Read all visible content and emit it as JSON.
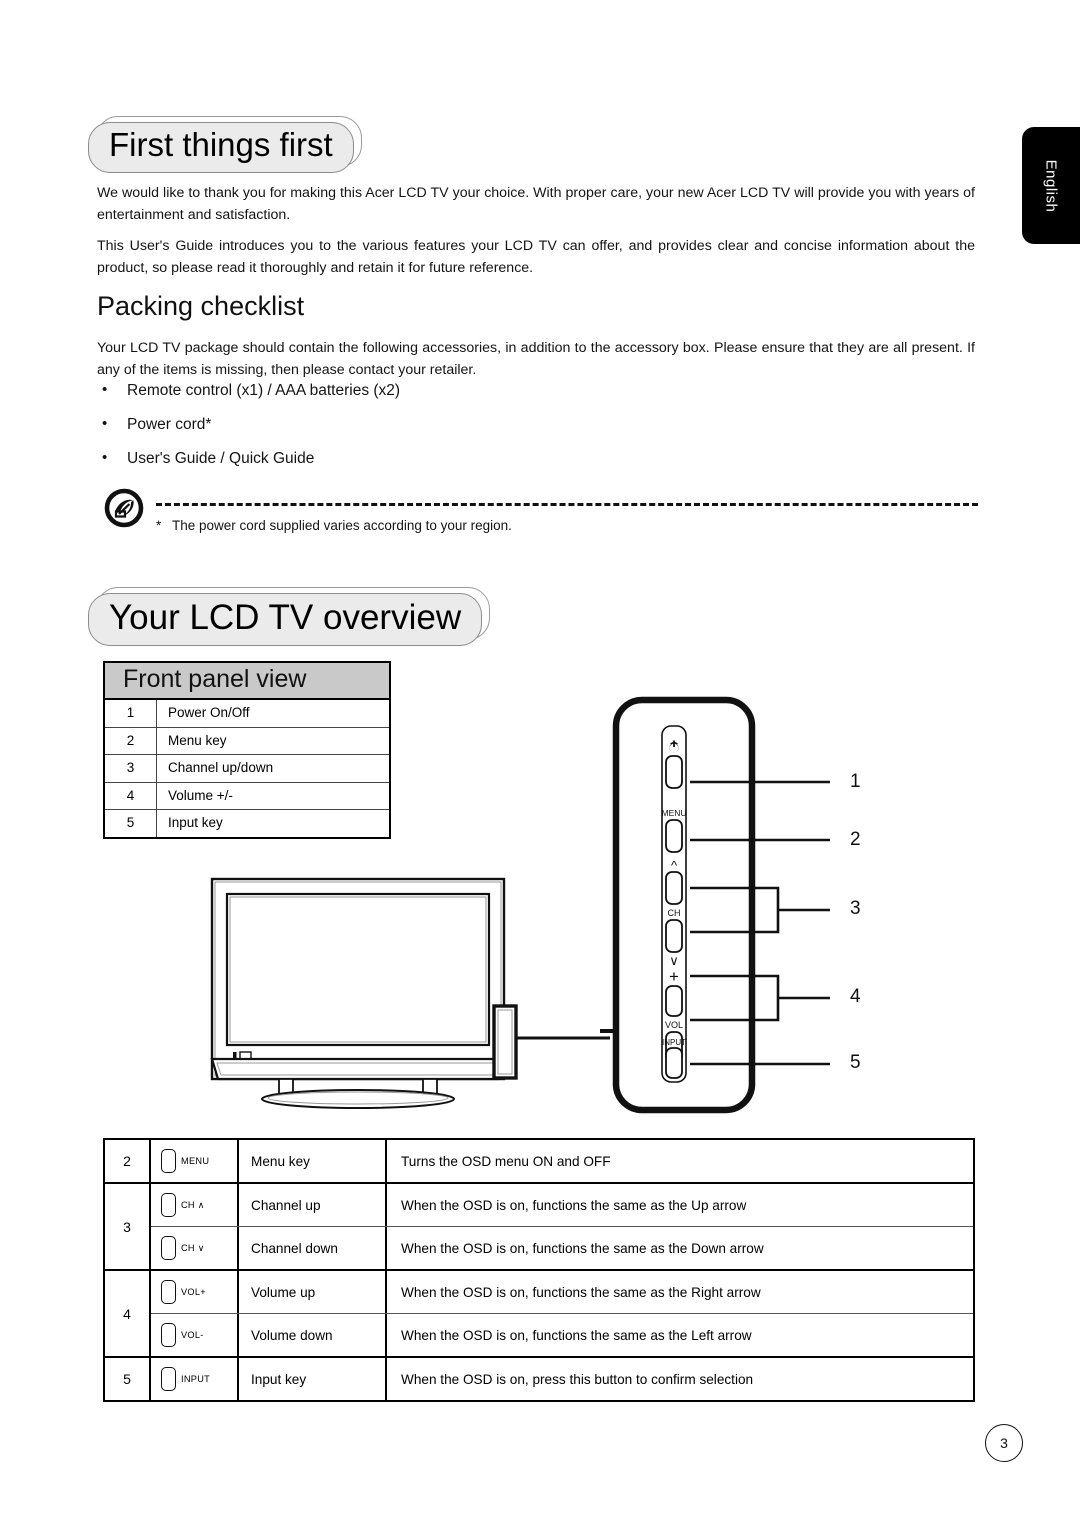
{
  "language_tab": {
    "label": "English"
  },
  "headings": {
    "first_things_first": "First things first",
    "packing_checklist": "Packing checklist",
    "lcd_tv_overview": "Your LCD TV overview"
  },
  "paragraphs": {
    "intro1": "We would like to thank you for making this Acer LCD TV your choice. With proper care, your new Acer LCD TV will provide you with years of entertainment and satisfaction.",
    "intro2": "This User's Guide introduces you to the various features your LCD TV can offer, and provides clear and concise information about the product, so please read it thoroughly and retain it for future reference.",
    "packing_intro": "Your LCD TV package should contain the following accessories, in addition to the accessory box. Please ensure that they are all present. If any of the items is missing, then please contact your retailer."
  },
  "packing_items": [
    "Remote control (x1) / AAA batteries (x2)",
    "Power cord*",
    "User's Guide / Quick Guide"
  ],
  "note": {
    "icon": "acer-note-icon",
    "marker": "*",
    "text": "The power cord supplied varies according to your region."
  },
  "front_panel_table": {
    "header": "Front panel view",
    "rows": [
      {
        "num": "1",
        "label": "Power On/Off"
      },
      {
        "num": "2",
        "label": "Menu key"
      },
      {
        "num": "3",
        "label": "Channel up/down"
      },
      {
        "num": "4",
        "label": "Volume +/-"
      },
      {
        "num": "5",
        "label": "Input key"
      }
    ]
  },
  "panel_diagram": {
    "button_labels": {
      "power": "power-icon",
      "menu": "MENU",
      "ch_up": "∧",
      "ch": "CH",
      "ch_down": "∨",
      "vol_up": "+",
      "vol": "VOL",
      "vol_down": "—",
      "input": "INPUT"
    },
    "callouts": [
      "1",
      "2",
      "3",
      "4",
      "5"
    ]
  },
  "key_table": {
    "groups": [
      {
        "num": "2",
        "rows": [
          {
            "icon_label": "MENU",
            "name": "Menu key",
            "desc": "Turns the OSD menu ON and OFF"
          }
        ]
      },
      {
        "num": "3",
        "rows": [
          {
            "icon_label": "CH ∧",
            "name": "Channel up",
            "desc": "When the OSD is on, functions the same as the Up arrow"
          },
          {
            "icon_label": "CH ∨",
            "name": "Channel down",
            "desc": "When the OSD is on, functions the same as the Down arrow"
          }
        ]
      },
      {
        "num": "4",
        "rows": [
          {
            "icon_label": "VOL+",
            "name": "Volume up",
            "desc": "When the OSD is on, functions the same as the Right arrow"
          },
          {
            "icon_label": "VOL-",
            "name": "Volume down",
            "desc": "When the OSD is on, functions the same as the Left arrow"
          }
        ]
      },
      {
        "num": "5",
        "rows": [
          {
            "icon_label": "INPUT",
            "name": "Input key",
            "desc": "When the OSD is on, press this button to confirm selection"
          }
        ]
      }
    ]
  },
  "footer": {
    "page_number": "3"
  },
  "colors": {
    "banner_fill": "#ebebeb",
    "banner_border": "#8c8c8c",
    "table_header_fill": "#c9c9c9",
    "tab_background": "#000000",
    "tab_text": "#ffffff"
  }
}
